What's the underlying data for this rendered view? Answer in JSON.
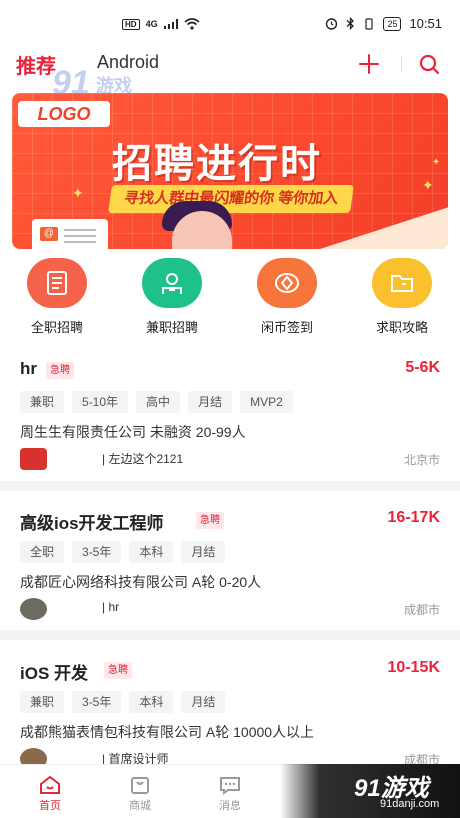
{
  "status_bar": {
    "network": "4G",
    "hd": "HD",
    "battery": "25",
    "time": "10:51"
  },
  "top_nav": {
    "tab_recommend": "推荐",
    "tab_android": "Android"
  },
  "watermark": {
    "brand_num": "91",
    "brand_text": "游戏",
    "url": "91danji.com"
  },
  "banner": {
    "logo": "LOGO",
    "headline": "招聘进行时",
    "subline": "寻找人群中最闪耀的你  等你加入",
    "doc_mark": "@"
  },
  "quick_entries": [
    {
      "label": "全职招聘",
      "color": "#f4624a",
      "icon": "doc-icon"
    },
    {
      "label": "兼职招聘",
      "color": "#1ec18a",
      "icon": "briefcase-icon"
    },
    {
      "label": "闲币签到",
      "color": "#f7743a",
      "icon": "coin-icon"
    },
    {
      "label": "求职攻略",
      "color": "#fbc02d",
      "icon": "folder-icon"
    }
  ],
  "jobs": [
    {
      "title": "hr",
      "urgent": "急聘",
      "salary": "5-6K",
      "tags": [
        "兼职",
        "5-10年",
        "高中",
        "月结",
        "MVP2"
      ],
      "company": "周生生有限责任公司 未融资 20-99人",
      "recruiter": "| 左边这个2121",
      "city": "北京市",
      "avatar_color": "#d8322d"
    },
    {
      "title": "高级ios开发工程师",
      "urgent": "急聘",
      "salary": "16-17K",
      "tags": [
        "全职",
        "3-5年",
        "本科",
        "月结"
      ],
      "company": "成都匠心网络科技有限公司 A轮 0-20人",
      "recruiter": "| hr",
      "city": "成都市",
      "avatar_color": "#6d6a62"
    },
    {
      "title": "iOS 开发",
      "urgent": "急聘",
      "salary": "10-15K",
      "tags": [
        "兼职",
        "3-5年",
        "本科",
        "月结"
      ],
      "company": "成都熊猫表情包科技有限公司 A轮 10000人以上",
      "recruiter": "| 首席设计师",
      "city": "成都市",
      "avatar_color": "#8a6a4a"
    }
  ],
  "bottom_nav": [
    {
      "label": "首页",
      "icon": "home-icon",
      "active": true
    },
    {
      "label": "商城",
      "icon": "bag-icon",
      "active": false
    },
    {
      "label": "消息",
      "icon": "message-icon",
      "active": false
    }
  ],
  "colors": {
    "accent": "#e8243a",
    "banner": "#fb4a2f"
  }
}
